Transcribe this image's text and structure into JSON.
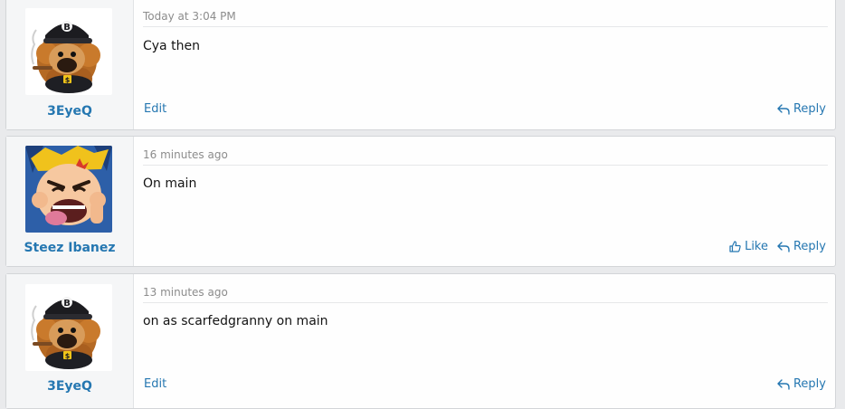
{
  "posts": [
    {
      "username": "3EyeQ",
      "avatar_icon": "pug-gangster-avatar-icon",
      "time": "Today at 3:04 PM",
      "body": "Cya then",
      "edit_label": "Edit",
      "reply_label": "Reply"
    },
    {
      "username": "Steez Ibanez",
      "avatar_icon": "cartoon-face-avatar-icon",
      "time": "16 minutes ago",
      "body": "On main",
      "like_label": "Like",
      "reply_label": "Reply"
    },
    {
      "username": "3EyeQ",
      "avatar_icon": "pug-gangster-avatar-icon",
      "time": "13 minutes ago",
      "body": "on as scarfedgranny on main",
      "edit_label": "Edit",
      "reply_label": "Reply"
    }
  ],
  "colors": {
    "link": "#2577b1",
    "page_background": "#e9eaec",
    "post_background": "#fefefe",
    "user_cell_background": "#f5f6f7"
  }
}
